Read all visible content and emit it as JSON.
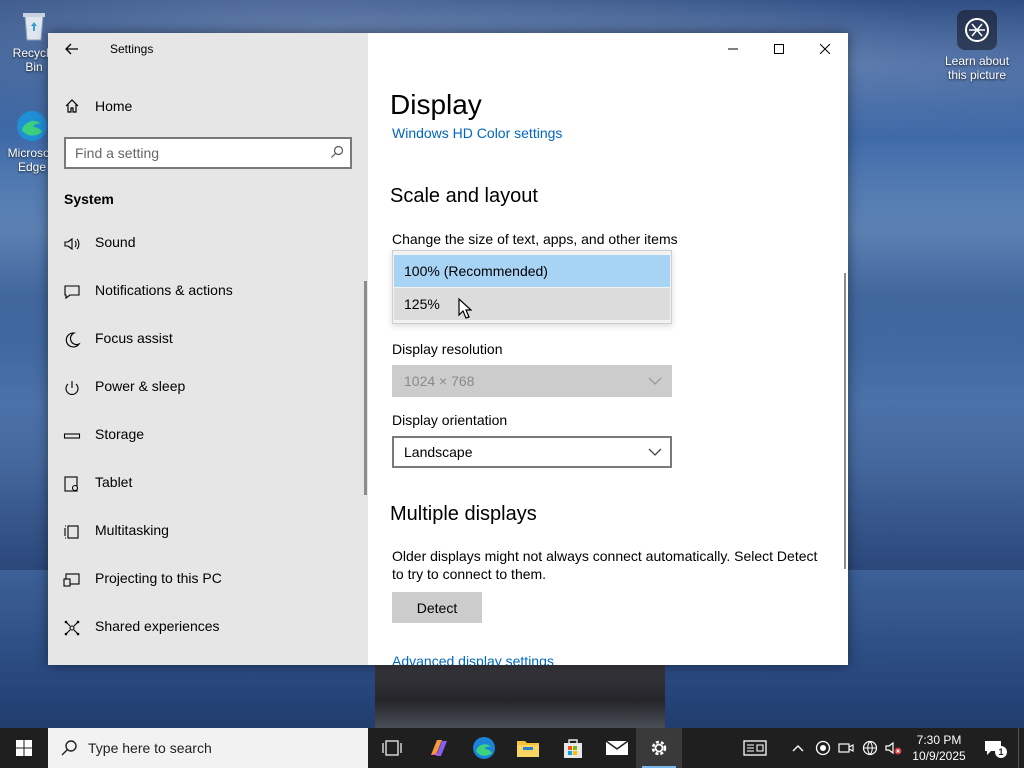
{
  "desktop": {
    "icons": [
      {
        "label": "Recycle Bin",
        "icon": "recycle-bin-icon"
      },
      {
        "label": "Microsoft Edge",
        "icon": "edge-icon"
      }
    ],
    "learn_about": "Learn about this picture"
  },
  "window": {
    "title": "Settings",
    "controls": {
      "minimize": "minimize-icon",
      "maximize": "maximize-icon",
      "close": "close-icon"
    }
  },
  "sidebar": {
    "home_label": "Home",
    "search": {
      "placeholder": "Find a setting",
      "value": ""
    },
    "section": "System",
    "items": [
      {
        "label": "Sound",
        "icon": "speaker-icon"
      },
      {
        "label": "Notifications & actions",
        "icon": "notification-icon"
      },
      {
        "label": "Focus assist",
        "icon": "moon-icon"
      },
      {
        "label": "Power & sleep",
        "icon": "power-icon"
      },
      {
        "label": "Storage",
        "icon": "storage-icon"
      },
      {
        "label": "Tablet",
        "icon": "tablet-icon"
      },
      {
        "label": "Multitasking",
        "icon": "multitasking-icon"
      },
      {
        "label": "Projecting to this PC",
        "icon": "projecting-icon"
      },
      {
        "label": "Shared experiences",
        "icon": "shared-experiences-icon"
      }
    ]
  },
  "main": {
    "title": "Display",
    "hd_color_link": "Windows HD Color settings",
    "scale_heading": "Scale and layout",
    "scale_label": "Change the size of text, apps, and other items",
    "scale_options": [
      {
        "label": "100% (Recommended)",
        "selected": true
      },
      {
        "label": "125%",
        "selected": false
      }
    ],
    "resolution_label": "Display resolution",
    "resolution_value": "1024 × 768",
    "orientation_label": "Display orientation",
    "orientation_value": "Landscape",
    "multiple_heading": "Multiple displays",
    "multiple_text": "Older displays might not always connect automatically. Select Detect to try to connect to them.",
    "detect_button": "Detect",
    "advanced_link": "Advanced display settings"
  },
  "taskbar": {
    "search_placeholder": "Type here to search",
    "apps": [
      "task-view-icon",
      "copilot-icon",
      "edge-icon",
      "file-explorer-icon",
      "store-icon",
      "mail-icon",
      "settings-icon"
    ],
    "time": "7:30 PM",
    "date": "10/9/2025",
    "notification_count": "1"
  },
  "colors": {
    "accent": "#0067c0",
    "selected_option": "#a7d3f5",
    "sidebar_bg": "#e6e6e6",
    "taskbar_bg": "#1f1f1f"
  }
}
